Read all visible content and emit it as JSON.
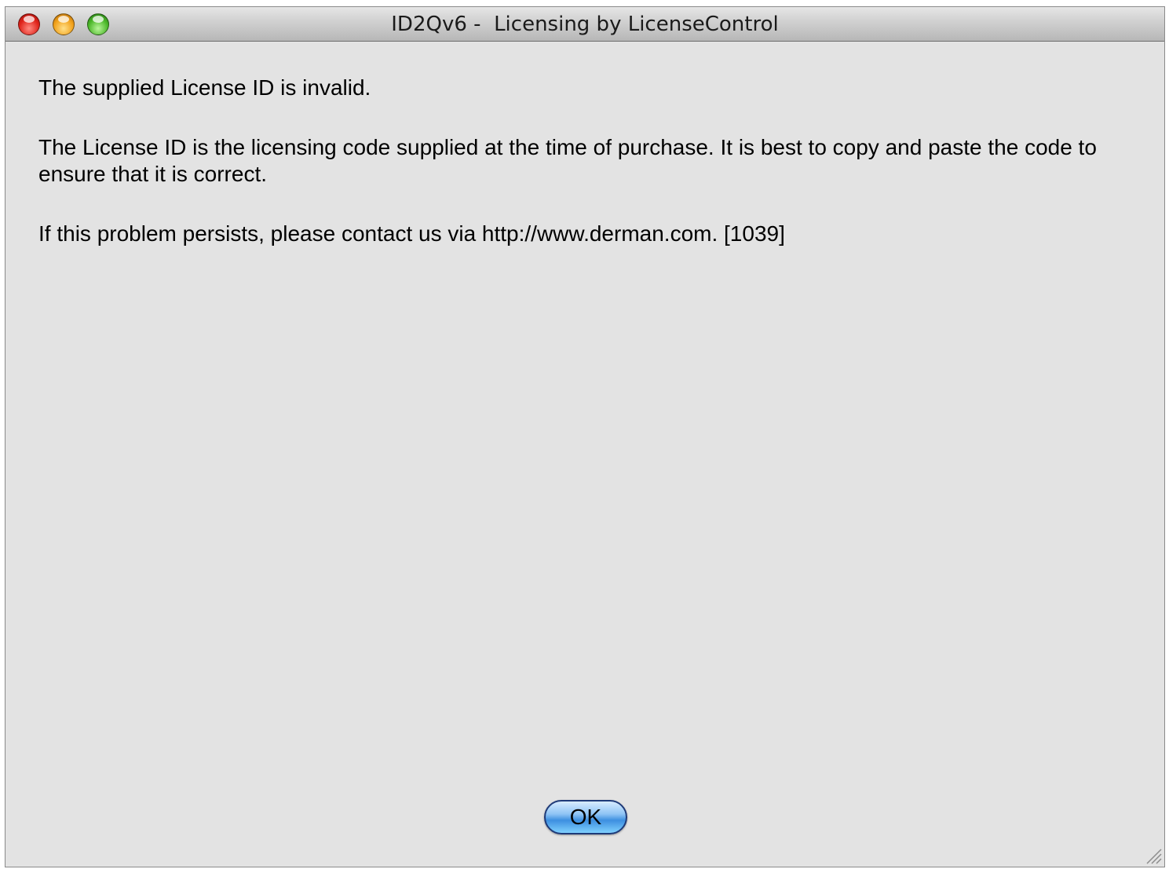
{
  "window": {
    "title": "ID2Qv6 -  Licensing by LicenseControl"
  },
  "message": {
    "line1": "The supplied License ID is invalid.",
    "line2": "The License ID is the licensing code supplied at the time of purchase. It is best to copy and paste the code to ensure that it is correct.",
    "line3": "If this problem persists, please contact us via http://www.derman.com. [1039]"
  },
  "buttons": {
    "ok_label": "OK"
  },
  "colors": {
    "window_bg": "#e3e3e3",
    "close": "#e0241b",
    "minimize": "#f2a21b",
    "zoom": "#4cb82a",
    "default_button": "#3d8fe0"
  }
}
